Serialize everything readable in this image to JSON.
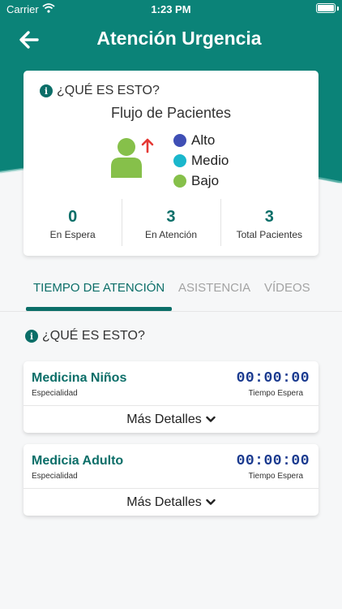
{
  "status_bar": {
    "carrier": "Carrier",
    "time": "1:23 PM"
  },
  "header": {
    "title": "Atención Urgencia"
  },
  "flow_card": {
    "info_text": "¿QUÉ ES ESTO?",
    "title": "Flujo de Pacientes",
    "legend": [
      {
        "label": "Alto",
        "color": "#3f4fb5"
      },
      {
        "label": "Medio",
        "color": "#1ab7cc"
      },
      {
        "label": "Bajo",
        "color": "#86c04a"
      }
    ],
    "stats": [
      {
        "value": "0",
        "label": "En Espera"
      },
      {
        "value": "3",
        "label": "En Atención"
      },
      {
        "value": "3",
        "label": "Total Pacientes"
      }
    ]
  },
  "tabs": [
    {
      "label": "TIEMPO DE ATENCIÓN",
      "active": true
    },
    {
      "label": "ASISTENCIA",
      "active": false
    },
    {
      "label": "VÍDEOS",
      "active": false
    }
  ],
  "section_info_text": "¿QUÉ ES ESTO?",
  "specialties": [
    {
      "name": "Medicina Niños",
      "sub": "Especialidad",
      "time": "00:00:00",
      "time_label": "Tiempo Espera",
      "details": "Más Detalles"
    },
    {
      "name": "Medicia Adulto",
      "sub": "Especialidad",
      "time": "00:00:00",
      "time_label": "Tiempo Espera",
      "details": "Más Detalles"
    }
  ],
  "colors": {
    "primary": "#0b8378",
    "accent_dark": "#0b6e68",
    "time_blue": "#1a3a8f",
    "arrow_red": "#e53935"
  }
}
